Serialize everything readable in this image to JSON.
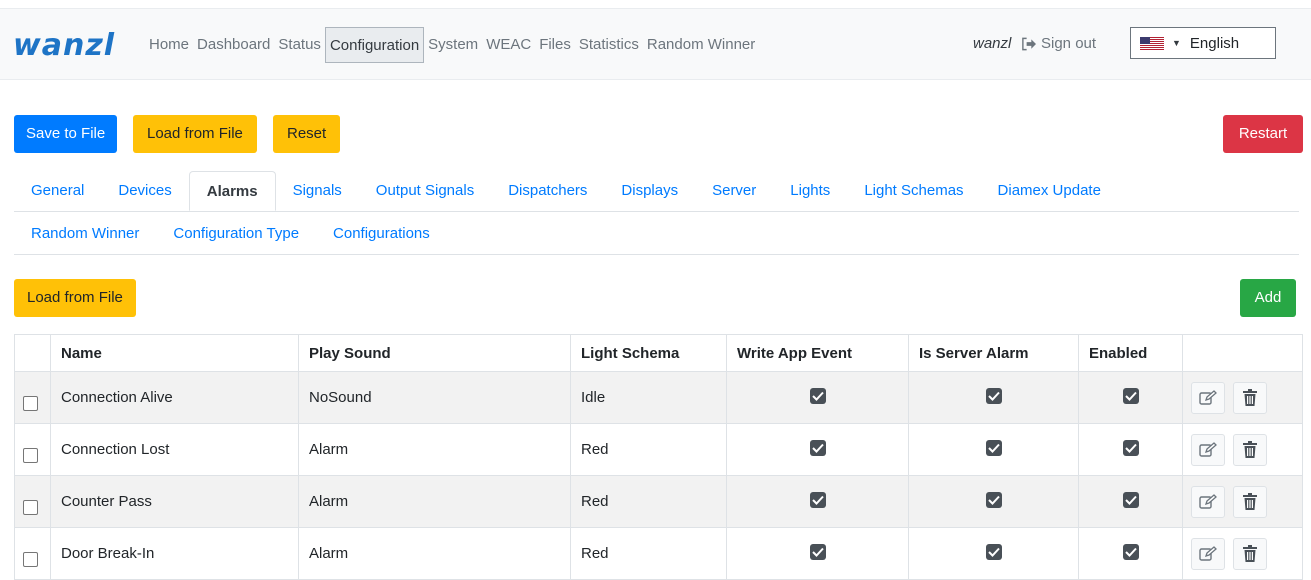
{
  "brand": "wanzl",
  "nav": {
    "items": [
      "Home",
      "Dashboard",
      "Status",
      "Configuration",
      "System",
      "WEAC",
      "Files",
      "Statistics",
      "Random Winner"
    ],
    "active": "Configuration",
    "user": "wanzl",
    "signout": "Sign out",
    "language": "English"
  },
  "toolbar": {
    "save_to_file": "Save to File",
    "load_from_file": "Load from File",
    "reset": "Reset",
    "restart": "Restart"
  },
  "tabs": {
    "row1": [
      "General",
      "Devices",
      "Alarms",
      "Signals",
      "Output Signals",
      "Dispatchers",
      "Displays",
      "Server",
      "Lights",
      "Light Schemas",
      "Diamex Update"
    ],
    "row2": [
      "Random Winner",
      "Configuration Type",
      "Configurations"
    ],
    "active": "Alarms"
  },
  "section": {
    "load_from_file": "Load from File",
    "add": "Add"
  },
  "table": {
    "columns": [
      "Name",
      "Play Sound",
      "Light Schema",
      "Write App Event",
      "Is Server Alarm",
      "Enabled"
    ],
    "rows": [
      {
        "name": "Connection Alive",
        "play_sound": "NoSound",
        "light_schema": "Idle",
        "write_app_event": true,
        "is_server_alarm": true,
        "enabled": true
      },
      {
        "name": "Connection Lost",
        "play_sound": "Alarm",
        "light_schema": "Red",
        "write_app_event": true,
        "is_server_alarm": true,
        "enabled": true
      },
      {
        "name": "Counter Pass",
        "play_sound": "Alarm",
        "light_schema": "Red",
        "write_app_event": true,
        "is_server_alarm": true,
        "enabled": true
      },
      {
        "name": "Door Break-In",
        "play_sound": "Alarm",
        "light_schema": "Red",
        "write_app_event": true,
        "is_server_alarm": true,
        "enabled": true
      }
    ]
  }
}
